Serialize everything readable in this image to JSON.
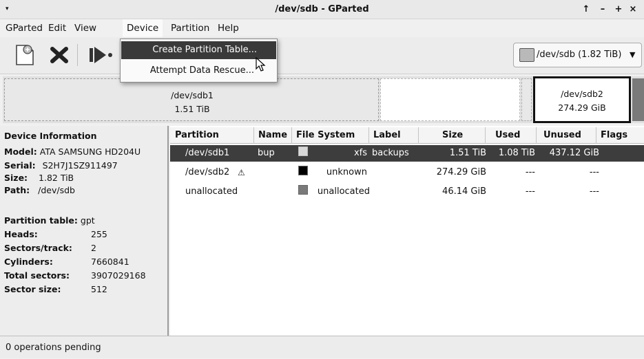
{
  "window": {
    "title": "/dev/sdb - GParted",
    "controls": {
      "pin": "↑",
      "minimize": "–",
      "maximize": "+",
      "close": "×"
    }
  },
  "menubar": [
    "GParted",
    "Edit",
    "View",
    "Device",
    "Partition",
    "Help"
  ],
  "device_menu": {
    "open_menu": "Device",
    "items": [
      "Create Partition Table...",
      "Attempt Data Rescue..."
    ],
    "highlighted": "Create Partition Table..."
  },
  "toolbar": {
    "buttons": [
      "new-partition-icon",
      "delete-icon",
      "resize-move-icon"
    ],
    "device_selector": "/dev/sdb (1.82 TiB)"
  },
  "visualizer": {
    "segments": [
      {
        "name": "/dev/sdb1",
        "size": "1.51 TiB"
      },
      {
        "name": "/dev/sdb2",
        "size": "274.29 GiB"
      }
    ]
  },
  "device_info": {
    "heading": "Device Information",
    "model_label": "Model:",
    "model": "ATA SAMSUNG HD204U",
    "serial_label": "Serial:",
    "serial": "S2H7J1SZ911497",
    "size_label": "Size:",
    "size": "1.82 TiB",
    "path_label": "Path:",
    "path": "/dev/sdb",
    "partition_table_label": "Partition table:",
    "partition_table": "gpt",
    "heads_label": "Heads:",
    "heads": "255",
    "sectors_track_label": "Sectors/track:",
    "sectors_track": "2",
    "cylinders_label": "Cylinders:",
    "cylinders": "7660841",
    "total_sectors_label": "Total sectors:",
    "total_sectors": "3907029168",
    "sector_size_label": "Sector size:",
    "sector_size": "512"
  },
  "table": {
    "columns": [
      "Partition",
      "Name",
      "File System",
      "Label",
      "Size",
      "Used",
      "Unused",
      "Flags"
    ],
    "rows": [
      {
        "partition": "/dev/sdb1",
        "name": "bup",
        "fs": "xfs",
        "label": "backups",
        "size": "1.51 TiB",
        "used": "1.08 TiB",
        "unused": "437.12 GiB",
        "flags": "",
        "fs_color": "#d8d8d8"
      },
      {
        "partition": "/dev/sdb2",
        "warning": "⚠",
        "name": "",
        "fs": "unknown",
        "label": "",
        "size": "274.29 GiB",
        "used": "---",
        "unused": "---",
        "flags": "",
        "fs_color": "#000000"
      },
      {
        "partition": "unallocated",
        "name": "",
        "fs": "unallocated",
        "label": "",
        "size": "46.14 GiB",
        "used": "---",
        "unused": "---",
        "flags": "",
        "fs_color": "#7a7a7a"
      }
    ]
  },
  "status": "0 operations pending"
}
